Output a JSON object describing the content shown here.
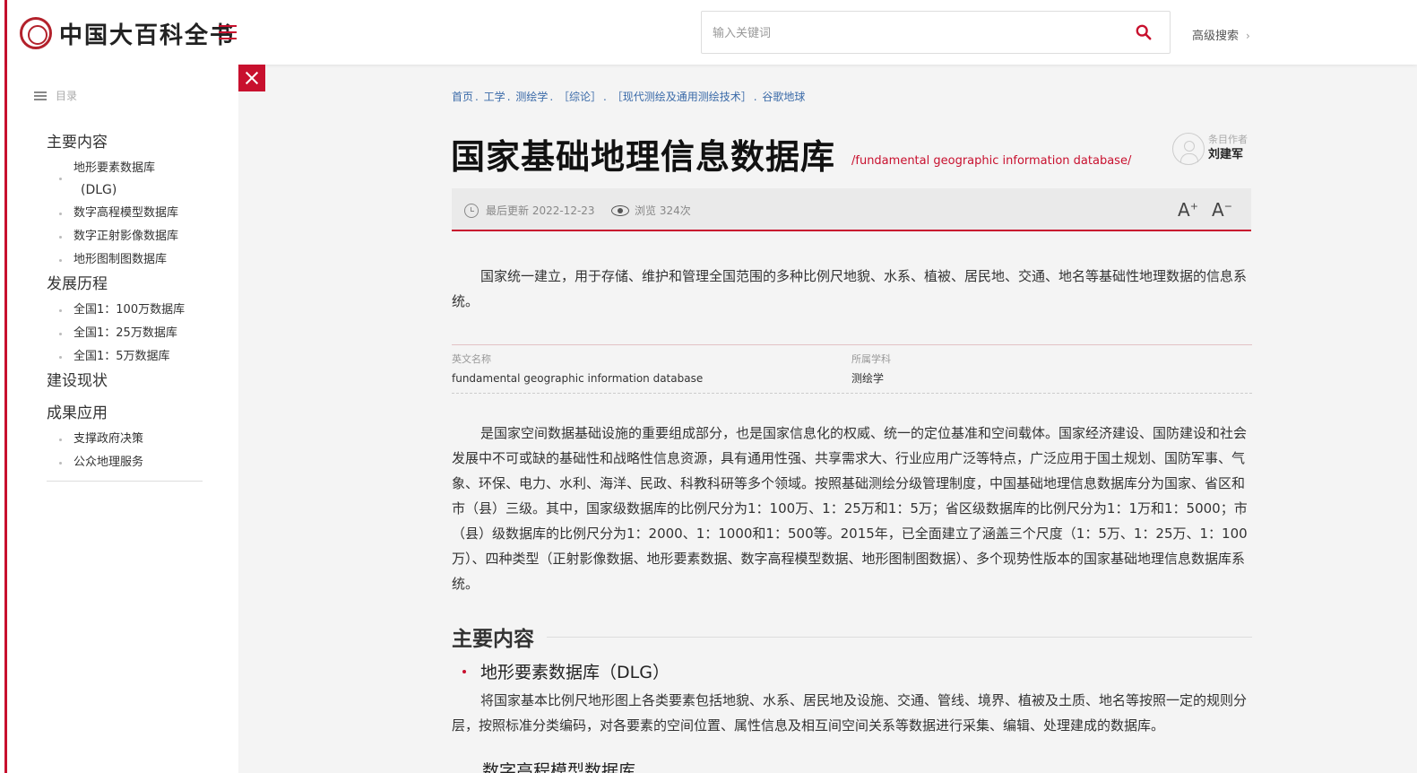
{
  "header": {
    "logo_text": "中国大百科全书",
    "search_placeholder": "输入关键词",
    "advanced_search": "高级搜索"
  },
  "sidebar": {
    "toc_label": "目录",
    "sections": [
      {
        "title": "主要内容",
        "items": [
          {
            "label": "地形要素数据库",
            "label2": "(DLG)"
          },
          {
            "label": "数字高程模型数据库"
          },
          {
            "label": "数字正射影像数据库"
          },
          {
            "label": "地形图制图数据库"
          }
        ]
      },
      {
        "title": "发展历程",
        "items": [
          {
            "label": "全国1：100万数据库"
          },
          {
            "label": "全国1：25万数据库"
          },
          {
            "label": "全国1：5万数据库"
          }
        ]
      },
      {
        "title": "建设现状",
        "items": []
      },
      {
        "title": "成果应用",
        "items": [
          {
            "label": "支撑政府决策"
          },
          {
            "label": "公众地理服务"
          }
        ]
      }
    ]
  },
  "breadcrumb": [
    "首页",
    "工学",
    "测绘学",
    "［综论］",
    "［现代测绘及通用测绘技术］",
    "谷歌地球"
  ],
  "article": {
    "title": "国家基础地理信息数据库",
    "subtitle": "/fundamental geographic information database/",
    "author_label": "条目作者",
    "author_name": "刘建军",
    "updated": "最后更新 2022-12-23",
    "views": "浏览 324次",
    "font_increase": "A",
    "font_decrease": "A",
    "intro": "国家统一建立，用于存储、维护和管理全国范围的多种比例尺地貌、水系、植被、居民地、交通、地名等基础性地理数据的信息系统。",
    "info": [
      {
        "label": "英文名称",
        "value": "fundamental geographic information database"
      },
      {
        "label": "所属学科",
        "value": "测绘学"
      }
    ],
    "body": "是国家空间数据基础设施的重要组成部分，也是国家信息化的权威、统一的定位基准和空间载体。国家经济建设、国防建设和社会发展中不可或缺的基础性和战略性信息资源，具有通用性强、共享需求大、行业应用广泛等特点，广泛应用于国土规划、国防军事、气象、环保、电力、水利、海洋、民政、科教科研等多个领域。按照基础测绘分级管理制度，中国基础地理信息数据库分为国家、省区和市（县）三级。其中，国家级数据库的比例尺分为1：100万、1：25万和1：5万；省区级数据库的比例尺分为1：1万和1：5000；市（县）级数据库的比例尺分为1：2000、1：1000和1：500等。2015年，已全面建立了涵盖三个尺度（1：5万、1：25万、1：100万）、四种类型（正射影像数据、地形要素数据、数字高程模型数据、地形图制图数据）、多个现势性版本的国家基础地理信息数据库系统。",
    "section1_title": "主要内容",
    "sub1_title": "地形要素数据库（DLG）",
    "sub1_text": "将国家基本比例尺地形图上各类要素包括地貌、水系、居民地及设施、交通、管线、境界、植被及土质、地名等按照一定的规则分层，按照标准分类编码，对各要素的空间位置、属性信息及相互间空间关系等数据进行采集、编辑、处理建成的数据库。",
    "sub2_title": "数字高程模型数据库"
  },
  "colors": {
    "accent": "#c8102e",
    "link": "#3a6aa8"
  }
}
